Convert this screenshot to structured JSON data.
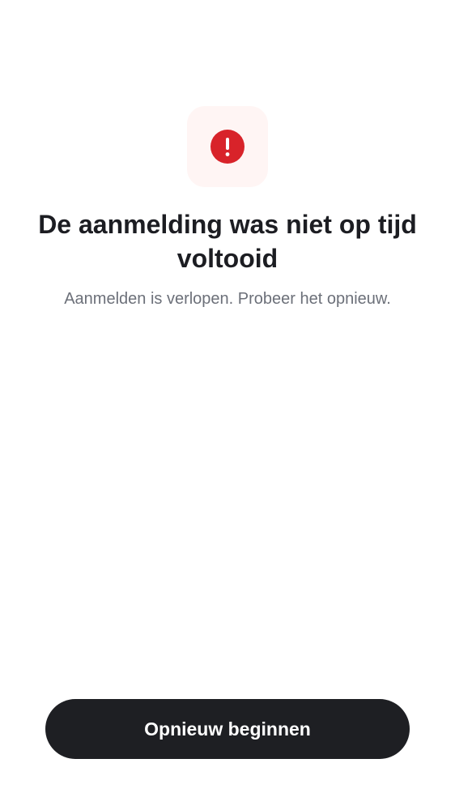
{
  "colors": {
    "error_red": "#D8232A",
    "tile_background": "#FFF5F4",
    "title_text": "#1C1D22",
    "subtitle_text": "#6C7079",
    "button_background": "#1E1F23",
    "button_text": "#FFFFFF"
  },
  "icon": {
    "name": "exclamation-circle-icon",
    "glyph": "!"
  },
  "message": {
    "title": "De aanmelding was niet op tijd voltooid",
    "subtitle": "Aanmelden is verlopen. Probeer het opnieuw."
  },
  "actions": {
    "restart_label": "Opnieuw beginnen"
  }
}
